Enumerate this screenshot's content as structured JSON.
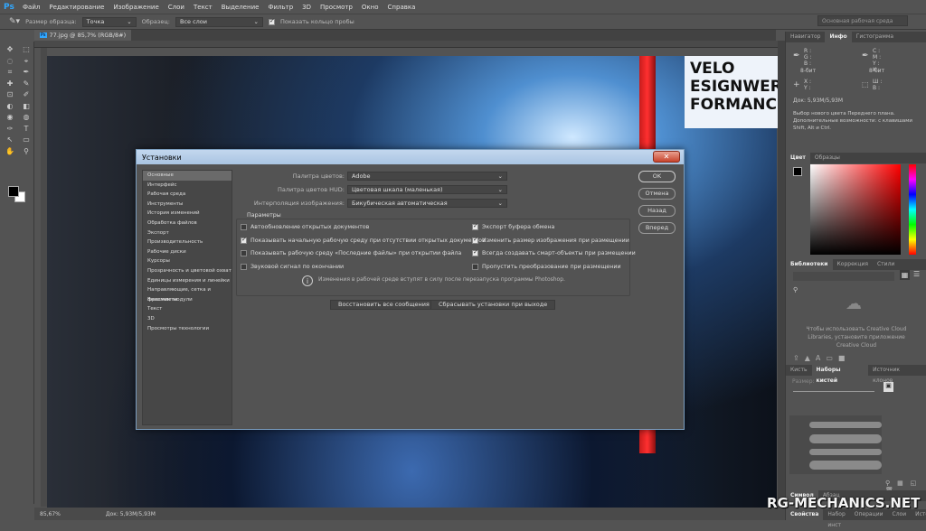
{
  "app": {
    "logo": "Ps",
    "menu": [
      "Файл",
      "Редактирование",
      "Изображение",
      "Слои",
      "Текст",
      "Выделение",
      "Фильтр",
      "3D",
      "Просмотр",
      "Окно",
      "Справка"
    ]
  },
  "options": {
    "sample_size_label": "Размер образца:",
    "sample_size_value": "Точка",
    "sample_label": "Образец:",
    "sample_value": "Все слои",
    "show_ring_label": "Показать кольцо пробы",
    "show_ring_checked": true,
    "workspace_search": "Основная рабочая среда"
  },
  "document": {
    "tab": "77.jpg @ 85,7% (RGB/8#)",
    "canvas_text": "VELO\nESIGNWER\nFORMANCE·TUNING·AUTO"
  },
  "status": {
    "zoom": "85,67%",
    "doc": "Док: 5,93M/5,93M"
  },
  "panels": {
    "info_tabs": [
      "Навигатор",
      "Инфо",
      "Гистограмма"
    ],
    "info": {
      "rgb": "R :\nG :\nB :",
      "cmyk": "C :\nM :\nY :\nK :",
      "bits1": "8-бит",
      "bits2": "8-бит",
      "xy": "X :\nY :",
      "wh": "Ш :\nВ :",
      "doc": "Док: 5,93M/5,93M",
      "hint": "Выбор нового цвета Переднего плана. Дополнительные возможности: с клавишами Shift, Alt и Ctrl."
    },
    "color_tabs": [
      "Цвет",
      "Образцы"
    ],
    "lib_tabs": [
      "Библиотеки",
      "Коррекция",
      "Стили"
    ],
    "lib_message": "Чтобы использовать Creative Cloud Libraries, установите приложение Creative Cloud",
    "brush_tabs": [
      "Кисть",
      "Наборы кистей",
      "Источник клонов"
    ],
    "brush_size_label": "Размер:",
    "char_tabs": [
      "Символ",
      "Абзац"
    ],
    "bottom_tabs": [
      "Свойства",
      "Набор инст",
      "Операции",
      "Слои",
      "История"
    ]
  },
  "dialog": {
    "title": "Установки",
    "categories": [
      "Основные",
      "Интерфейс",
      "Рабочая среда",
      "Инструменты",
      "История изменений",
      "Обработка файлов",
      "Экспорт",
      "Производительность",
      "Рабочие диски",
      "Курсоры",
      "Прозрачность и цветовой охват",
      "Единицы измерения и линейки",
      "Направляющие, сетка и фрагменты",
      "Внешние модули",
      "Текст",
      "3D",
      "Просмотры технологии"
    ],
    "selected_category": "Основные",
    "color_picker_label": "Палитра цветов:",
    "color_picker_value": "Adobe",
    "hud_label": "Палитра цветов HUD:",
    "hud_value": "Цветовая шкала (маленькая)",
    "interp_label": "Интерполяция изображения:",
    "interp_value": "Бикубическая автоматическая",
    "params_title": "Параметры",
    "options_left": [
      {
        "label": "Автообновление открытых документов",
        "checked": false
      },
      {
        "label": "Показывать начальную рабочую среду при отсутствии открытых документов",
        "checked": true
      },
      {
        "label": "Показывать рабочую среду «Последние файлы» при открытии файла",
        "checked": false
      },
      {
        "label": "Звуковой сигнал по окончании",
        "checked": false
      }
    ],
    "options_right": [
      {
        "label": "Экспорт буфера обмена",
        "checked": true
      },
      {
        "label": "Изменить размер изображения при размещении",
        "checked": true
      },
      {
        "label": "Всегда создавать смарт-объекты при размещении",
        "checked": true
      },
      {
        "label": "Пропустить преобразование при размещении",
        "checked": false
      }
    ],
    "info_note": "Изменения в рабочей среде вступят в силу после перезапуска программы Photoshop.",
    "reset_messages": "Восстановить все сообщения",
    "reset_on_quit": "Сбрасывать установки при выходе",
    "buttons": {
      "ok": "OK",
      "cancel": "Отмена",
      "back": "Назад",
      "next": "Вперед"
    }
  },
  "watermark": "RG-MECHANICS.NET",
  "colors": {
    "ui_bg": "#535353",
    "accent": "#31a8ff",
    "fg": "#000000",
    "bg": "#ffffff",
    "hue": "#ff0000"
  }
}
